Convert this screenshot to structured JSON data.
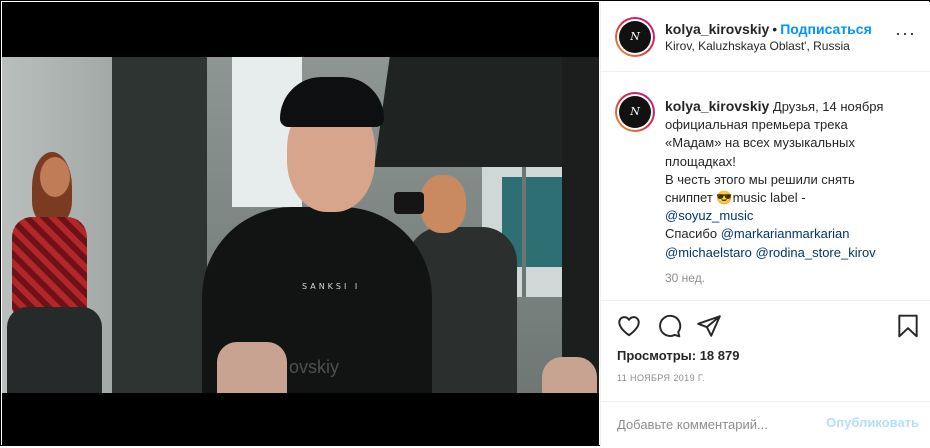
{
  "post": {
    "username": "kolya_kirovskiy",
    "separator": "•",
    "follow_label": "Подписаться",
    "location": "Kirov, Kaluzhskaya Oblast', Russia",
    "more_label": "···",
    "avatar_text": "N"
  },
  "video": {
    "shirt_text": "SANKSI I",
    "watermark": "ovskiy"
  },
  "caption": {
    "username": "kolya_kirovskiy",
    "lines": [
      "Друзья, 14 ноября",
      "официальная премьера трека",
      "«Мадам» на всех музыкальных",
      "площадках!",
      "В честь этого мы решили снять",
      "сниппет",
      "music label -"
    ],
    "emoji": "😎",
    "mention_soyuz": "@soyuz_music",
    "thanks": "Спасибо",
    "mention_markarian": "@markarianmarkarian",
    "mention_michael": "@michaelstaro",
    "mention_rodina": "@rodina_store_kirov",
    "time_ago": "30 нед."
  },
  "actions": {
    "like_icon": "heart-icon",
    "comment_icon": "comment-icon",
    "share_icon": "share-icon",
    "save_icon": "bookmark-icon",
    "views_label": "Просмотры: 18 879",
    "date": "11 НОЯБРЯ 2019 Г."
  },
  "comment": {
    "placeholder": "Добавьте комментарий...",
    "publish_label": "Опубликовать"
  },
  "colors": {
    "accent": "#0095f6",
    "mention": "#00376b",
    "publish_disabled": "#b2dffc",
    "muted": "#8e8e8e"
  }
}
